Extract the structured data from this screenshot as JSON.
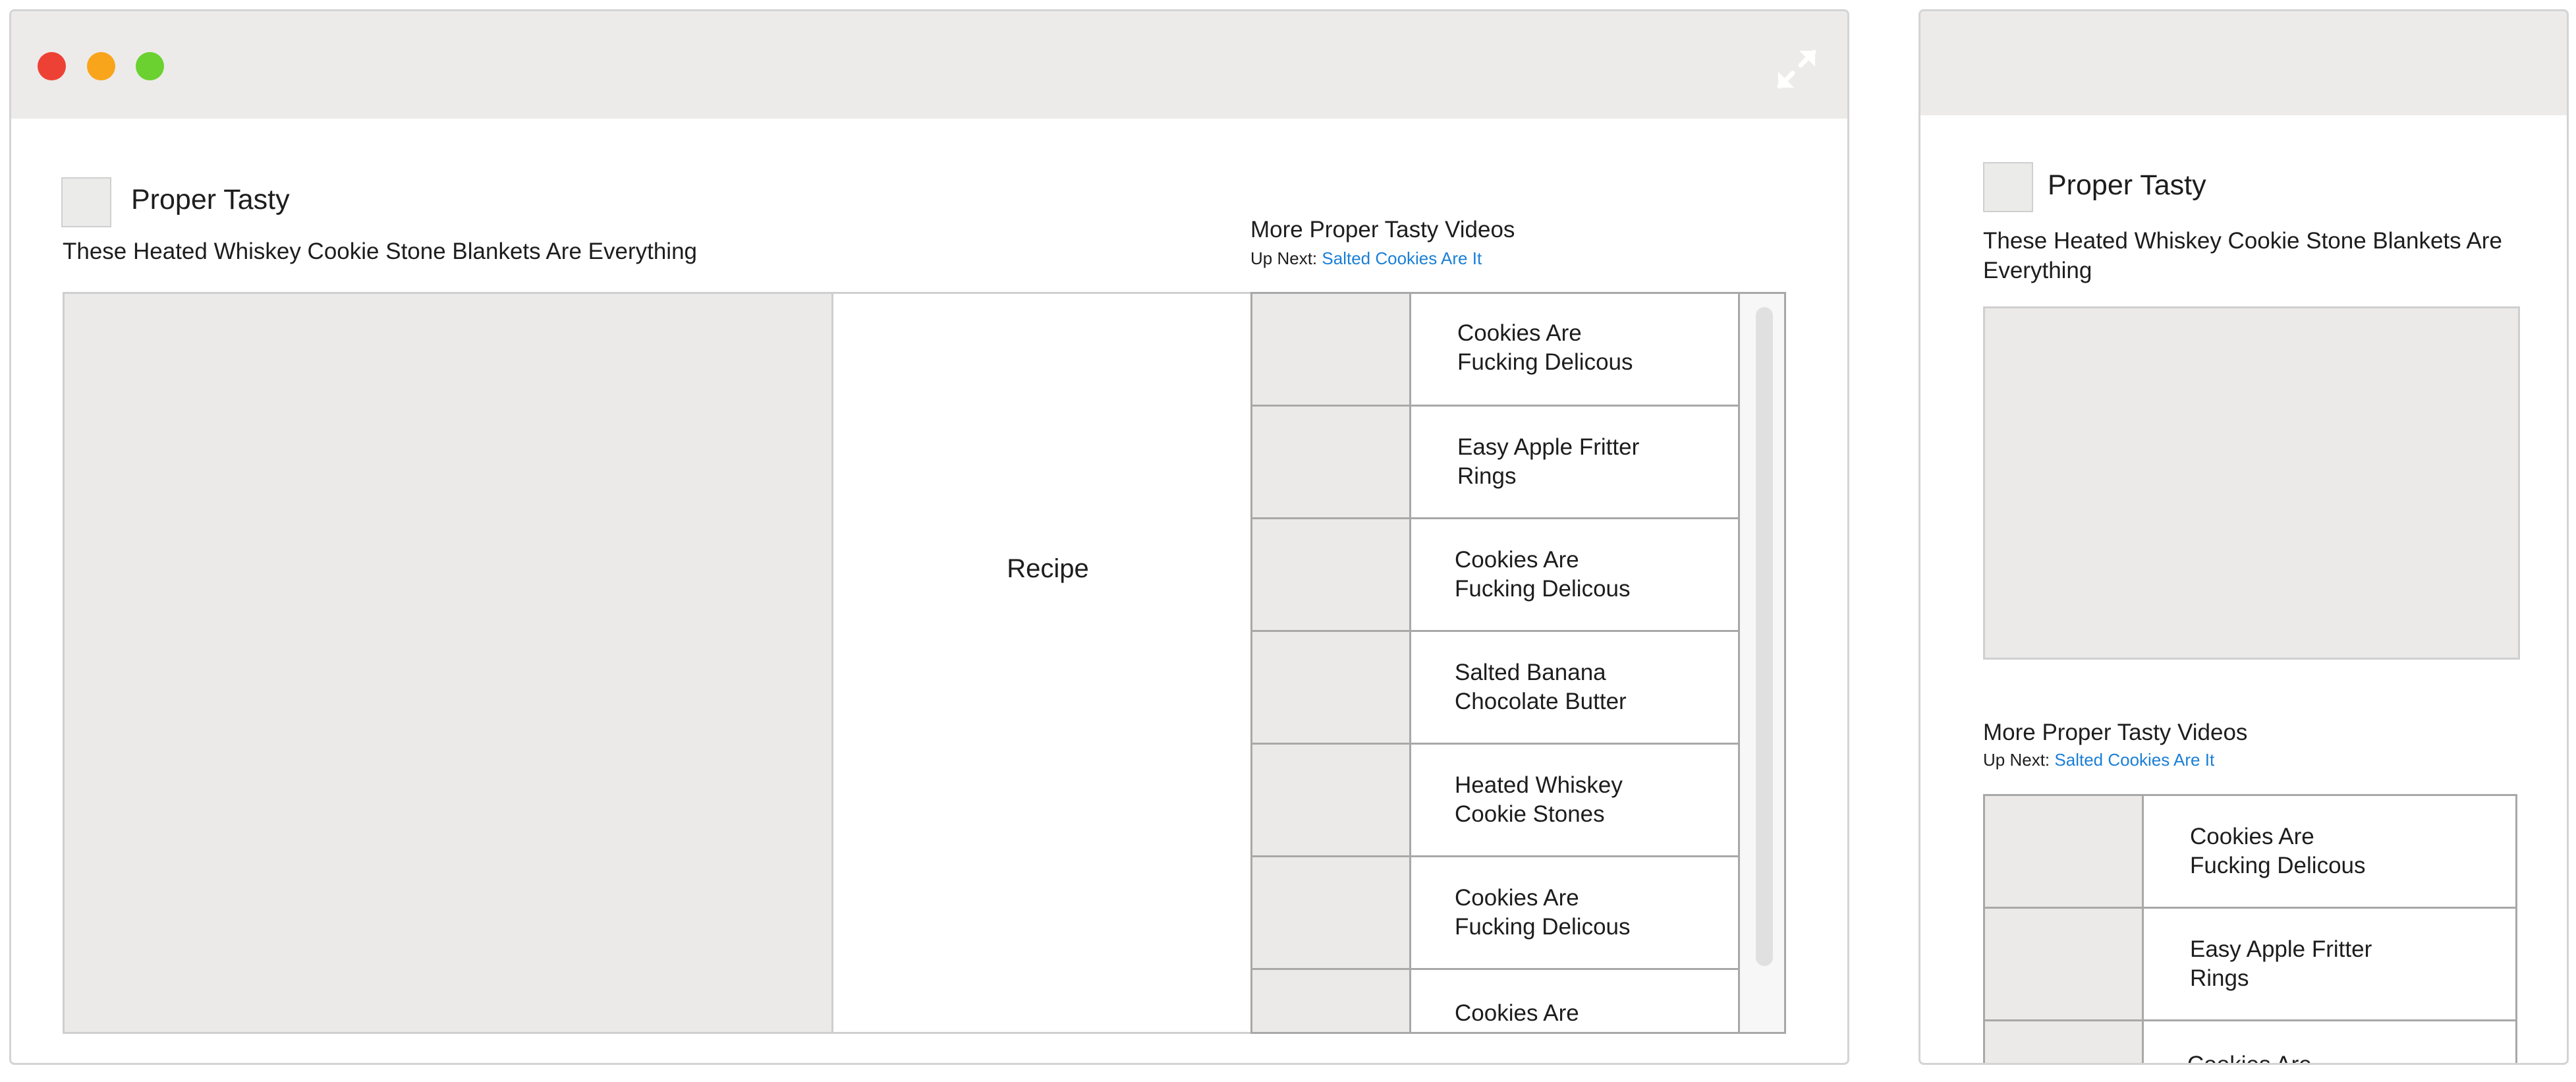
{
  "desktop": {
    "expand_icon": "expand-arrows-icon",
    "channel": "Proper Tasty",
    "video_title": "These Heated Whiskey Cookie Stone Blankets Are Everything",
    "recipe_label": "Recipe",
    "more_title": "More Proper Tasty Videos",
    "up_next_prefix": "Up Next:",
    "up_next_link": "Salted Cookies Are It",
    "items": [
      {
        "line1": "Cookies Are",
        "line2": "Fucking Delicous"
      },
      {
        "line1": "Easy Apple Fritter",
        "line2": "Rings"
      },
      {
        "line1": "Cookies Are",
        "line2": "Fucking Delicous"
      },
      {
        "line1": "Salted Banana",
        "line2": "Chocolate Butter"
      },
      {
        "line1": "Heated Whiskey",
        "line2": "Cookie Stones"
      },
      {
        "line1": "Cookies Are",
        "line2": "Fucking Delicous"
      },
      {
        "line1": "Cookies Are",
        "line2": ""
      }
    ]
  },
  "mobile": {
    "channel": "Proper Tasty",
    "video_title_line1": "These Heated Whiskey Cookie Stone Blankets Are",
    "video_title_line2": "Everything",
    "more_title": "More Proper Tasty Videos",
    "up_next_prefix": "Up Next:",
    "up_next_link": "Salted Cookies Are It",
    "items": [
      {
        "line1": "Cookies Are",
        "line2": "Fucking Delicous"
      },
      {
        "line1": "Easy Apple Fritter",
        "line2": "Rings"
      },
      {
        "line1": "Cookies Are",
        "line2": ""
      }
    ]
  },
  "colors": {
    "close": "#ee4135",
    "minimize": "#f9a51b",
    "maximize": "#6ad130",
    "link": "#1a7fd6",
    "placeholder": "#ebeae8"
  }
}
